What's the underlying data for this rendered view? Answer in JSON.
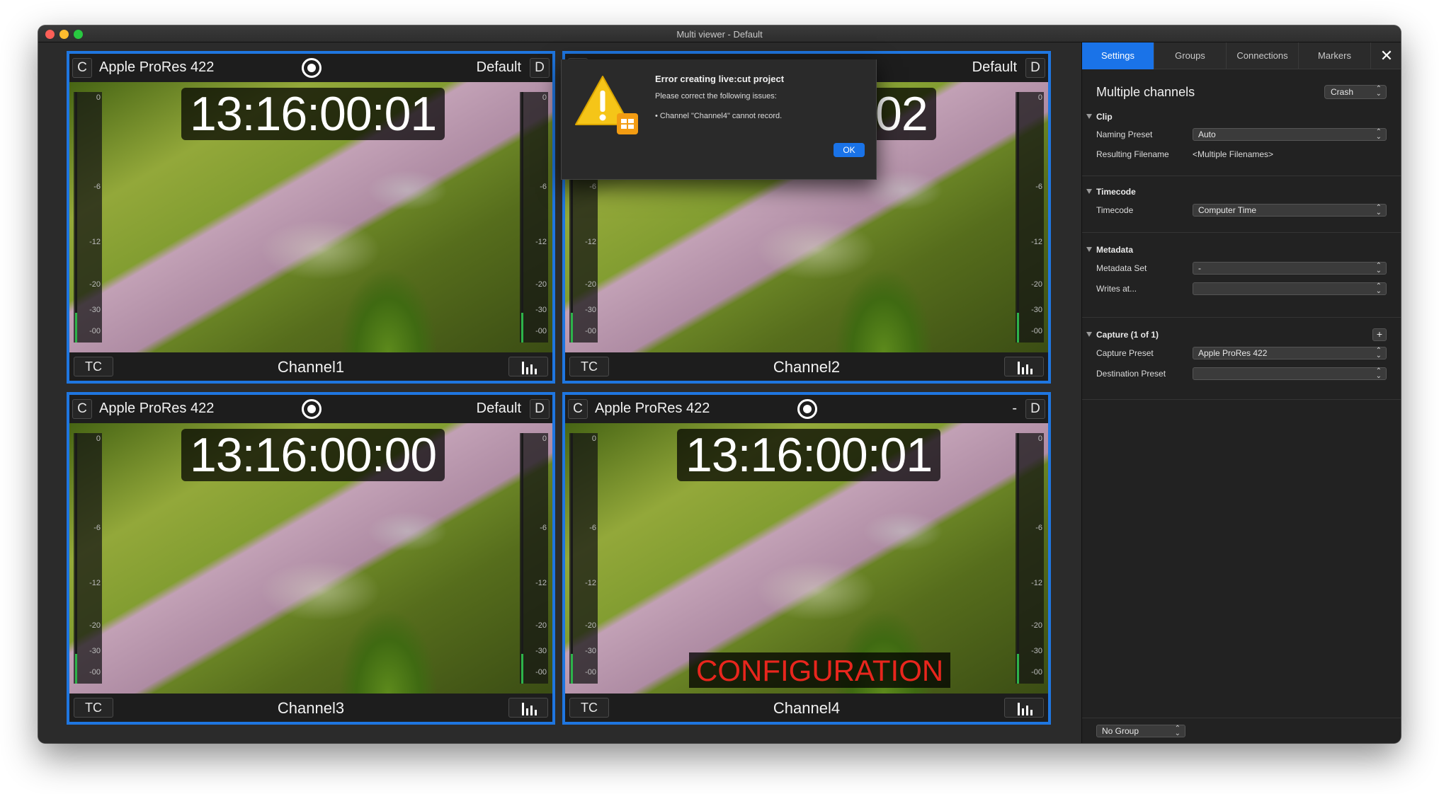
{
  "window": {
    "title": "Multi viewer - Default"
  },
  "tiles": [
    {
      "left_btn": "C",
      "preset": "Apple ProRes 422",
      "right_label": "Default",
      "right_btn": "D",
      "timecode": "13:16:00:01",
      "tc_btn": "TC",
      "channel": "Channel1",
      "overlay": ""
    },
    {
      "left_btn": "C",
      "preset": "",
      "right_label": "Default",
      "right_btn": "D",
      "timecode": "02",
      "tc_btn": "TC",
      "channel": "Channel2",
      "overlay": ""
    },
    {
      "left_btn": "C",
      "preset": "Apple ProRes 422",
      "right_label": "Default",
      "right_btn": "D",
      "timecode": "13:16:00:00",
      "tc_btn": "TC",
      "channel": "Channel3",
      "overlay": ""
    },
    {
      "left_btn": "C",
      "preset": "Apple ProRes 422",
      "right_label": "-",
      "right_btn": "D",
      "timecode": "13:16:00:01",
      "tc_btn": "TC",
      "channel": "Channel4",
      "overlay": "CONFIGURATION"
    }
  ],
  "meter_scale": [
    "0",
    "-6",
    "-12",
    "-20",
    "-30",
    "-00"
  ],
  "dialog": {
    "title": "Error creating live:cut project",
    "message": "Please correct the following issues:",
    "item": "• Channel \"Channel4\" cannot record.",
    "ok": "OK"
  },
  "panel": {
    "tabs": [
      "Settings",
      "Groups",
      "Connections",
      "Markers"
    ],
    "close": "✕",
    "heading": "Multiple channels",
    "mode_select": "Crash",
    "sections": {
      "clip": {
        "title": "Clip",
        "naming_label": "Naming Preset",
        "naming_value": "Auto",
        "filename_label": "Resulting Filename",
        "filename_value": "<Multiple Filenames>"
      },
      "timecode": {
        "title": "Timecode",
        "label": "Timecode",
        "value": "Computer Time"
      },
      "metadata": {
        "title": "Metadata",
        "set_label": "Metadata Set",
        "set_value": "-",
        "writes_label": "Writes at...",
        "writes_value": ""
      },
      "capture": {
        "title": "Capture (1 of 1)",
        "add": "+",
        "capture_label": "Capture Preset",
        "capture_value": "Apple ProRes 422",
        "dest_label": "Destination Preset",
        "dest_value": ""
      }
    },
    "group_select": "No Group"
  },
  "colors": {
    "accent": "#1a73e8",
    "tile_border": "#1f76e0",
    "config_text": "#e8261d",
    "meter_green": "#2db34a"
  }
}
